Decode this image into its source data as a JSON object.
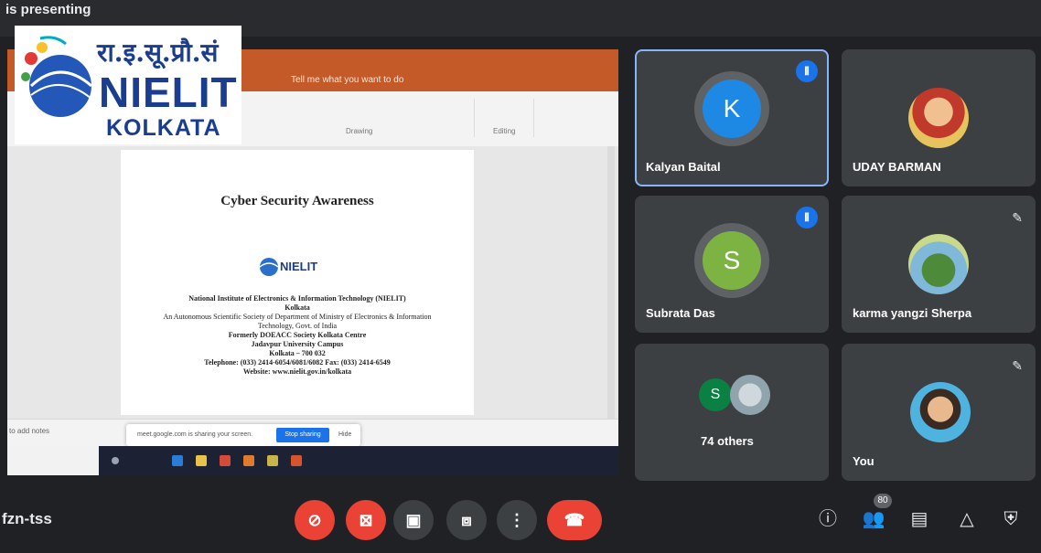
{
  "presenting_banner": "is presenting",
  "logo": {
    "hindi": "रा.इ.सू.प्रौ.सं",
    "name": "NIELIT",
    "city": "KOLKATA"
  },
  "powerpoint": {
    "tell_me": "Tell me what you want to do",
    "ribbon_groups": [
      "Drawing",
      "Editing"
    ],
    "slide": {
      "title": "Cyber Security Awareness",
      "logo_text": "NIELIT",
      "lines": [
        "National Institute of Electronics & Information Technology (NIELIT)",
        "Kolkata",
        "An Autonomous Scientific Society of Department of Ministry of Electronics & Information",
        "Technology, Govt. of India",
        "Formerly DOEACC Society Kolkata Centre",
        "Jadavpur University Campus",
        "Kolkata – 700 032",
        "Telephone: (033) 2414-6054/6081/6082    Fax: (033) 2414-6549",
        "Website: www.nielit.gov.in/kolkata"
      ]
    },
    "notes_hint": "to add notes",
    "share_bar": {
      "message": "meet.google.com is sharing your screen.",
      "stop": "Stop sharing",
      "hide": "Hide"
    }
  },
  "participants": [
    {
      "name": "Kalyan Baital",
      "initial": "K",
      "color": "#1e88e5",
      "speaking": true,
      "muted": false
    },
    {
      "name": "UDAY BARMAN",
      "photo": true,
      "speaking": false,
      "muted": false
    },
    {
      "name": "Subrata Das",
      "initial": "S",
      "color": "#7cb342",
      "speaking": true,
      "muted": false
    },
    {
      "name": "karma yangzi Sherpa",
      "photo": true,
      "speaking": false,
      "muted": true
    },
    {
      "name": "74 others",
      "initial": "S",
      "color": "#0b8043",
      "speaking": false,
      "muted": false
    },
    {
      "name": "You",
      "photo": true,
      "speaking": false,
      "muted": true
    }
  ],
  "bottom_bar": {
    "meeting_code": "fzn-tss",
    "participant_count": "80",
    "icons": [
      "mic-off-icon",
      "camera-off-icon",
      "captions-icon",
      "present-icon",
      "more-icon",
      "hangup-icon",
      "info-icon",
      "people-icon",
      "chat-icon",
      "activities-icon",
      "host-controls-icon"
    ]
  }
}
